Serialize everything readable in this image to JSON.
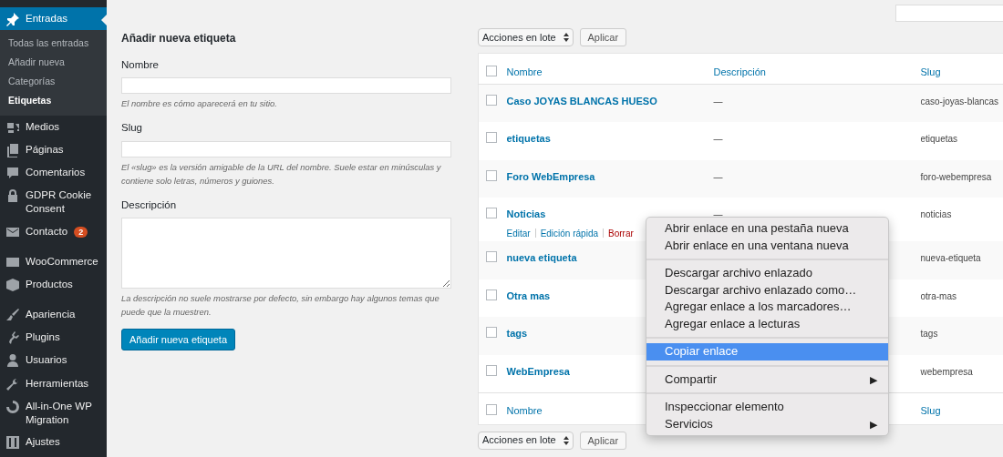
{
  "sidebar": {
    "items": [
      {
        "label": "Entradas",
        "selected": true,
        "children": [
          {
            "label": "Todas las entradas",
            "selected": false
          },
          {
            "label": "Añadir nueva",
            "selected": false
          },
          {
            "label": "Categorías",
            "selected": false
          },
          {
            "label": "Etiquetas",
            "selected": true
          }
        ]
      },
      {
        "label": "Medios",
        "selected": false
      },
      {
        "label": "Páginas",
        "selected": false
      },
      {
        "label": "Comentarios",
        "selected": false
      },
      {
        "label": "GDPR Cookie Consent",
        "selected": false
      },
      {
        "label": "Contacto",
        "selected": false,
        "badge": "2"
      },
      {
        "kind": "separator"
      },
      {
        "label": "WooCommerce",
        "selected": false
      },
      {
        "label": "Productos",
        "selected": false
      },
      {
        "kind": "separator"
      },
      {
        "label": "Apariencia",
        "selected": false
      },
      {
        "label": "Plugins",
        "selected": false
      },
      {
        "label": "Usuarios",
        "selected": false
      },
      {
        "label": "Herramientas",
        "selected": false
      },
      {
        "label": "All-in-One WP Migration",
        "selected": false
      },
      {
        "label": "Ajustes",
        "selected": false
      }
    ]
  },
  "add_form": {
    "title": "Añadir nueva etiqueta",
    "fields": [
      {
        "kind": "input",
        "label": "Nombre",
        "help": "El nombre es cómo aparecerá en tu sitio."
      },
      {
        "kind": "input",
        "label": "Slug",
        "help": "El «slug» es la versión amigable de la URL del nombre. Suele estar en minúsculas y contiene solo letras, números y guiones."
      },
      {
        "kind": "textarea",
        "label": "Descripción",
        "help": "La descripción no suele mostrarse por defecto, sin embargo hay algunos temas que puede que la muestren."
      }
    ],
    "submit": "Añadir nueva etiqueta"
  },
  "bulk_actions": {
    "select": "Acciones en lote",
    "apply": "Aplicar"
  },
  "table": {
    "header_checked": false,
    "footer_checked": false,
    "columns": [
      "Nombre",
      "Descripción",
      "Slug"
    ],
    "rows": [
      {
        "name": "Caso JOYAS BLANCAS HUESO",
        "description": "—",
        "slug": "caso-joyas-blancas",
        "checked": false
      },
      {
        "name": "etiquetas",
        "description": "—",
        "slug": "etiquetas",
        "checked": false
      },
      {
        "name": "Foro WebEmpresa",
        "description": "—",
        "slug": "foro-webempresa",
        "checked": false
      },
      {
        "name": "Noticias",
        "description": "—",
        "slug": "noticias",
        "checked": false,
        "actions": [
          {
            "label": "Editar",
            "kind": "link"
          },
          {
            "label": "Edición rápida",
            "kind": "link"
          },
          {
            "label": "Borrar",
            "kind": "delete"
          }
        ]
      },
      {
        "name": "nueva etiqueta",
        "slug": "nueva-etiqueta",
        "checked": false
      },
      {
        "name": "Otra mas",
        "slug": "otra-mas",
        "checked": false
      },
      {
        "name": "tags",
        "slug": "tags",
        "checked": false
      },
      {
        "name": "WebEmpresa",
        "slug": "webempresa",
        "checked": false
      }
    ],
    "footer_columns": [
      "Nombre",
      "Slug"
    ]
  },
  "bulk_actions_bottom": {
    "select": "Acciones en lote",
    "apply": "Aplicar"
  },
  "context_menu": {
    "items": [
      {
        "kind": "item",
        "label": "Abrir enlace en una pestaña nueva",
        "selected": false
      },
      {
        "kind": "item",
        "label": "Abrir enlace en una ventana nueva",
        "selected": false
      },
      {
        "kind": "separator"
      },
      {
        "kind": "item",
        "label": "Descargar archivo enlazado",
        "selected": false
      },
      {
        "kind": "item",
        "label": "Descargar archivo enlazado como…",
        "selected": false
      },
      {
        "kind": "item",
        "label": "Agregar enlace a los marcadores…",
        "selected": false
      },
      {
        "kind": "item",
        "label": "Agregar enlace a lecturas",
        "selected": false
      },
      {
        "kind": "separator"
      },
      {
        "kind": "item",
        "label": "Copiar enlace",
        "selected": true
      },
      {
        "kind": "separator"
      },
      {
        "kind": "item",
        "label": "Compartir",
        "selected": false,
        "submenu": "▶"
      },
      {
        "kind": "separator"
      },
      {
        "kind": "item",
        "label": "Inspeccionar elemento",
        "selected": false
      },
      {
        "kind": "item",
        "label": "Servicios",
        "selected": false,
        "submenu": "▶"
      }
    ]
  }
}
